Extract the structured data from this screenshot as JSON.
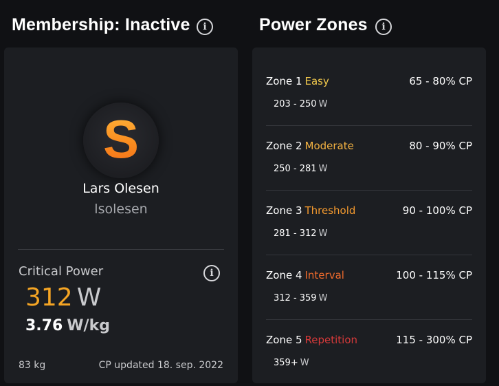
{
  "membership": {
    "title": "Membership: Inactive",
    "info_icon": "info-icon"
  },
  "profile": {
    "avatar_letter": "S",
    "name": "Lars Olesen",
    "username": "lsolesen"
  },
  "critical_power": {
    "label": "Critical Power",
    "value": "312",
    "unit": "W",
    "wkg_value": "3.76",
    "wkg_unit": "W/kg",
    "weight": "83 kg",
    "updated": "CP updated 18. sep. 2022"
  },
  "power_zones": {
    "title": "Power Zones",
    "zones": [
      {
        "prefix": "Zone 1",
        "label": "Easy",
        "color": "#f2c94c",
        "pct": "65 - 80% CP",
        "range": "203 - 250",
        "unit": "W"
      },
      {
        "prefix": "Zone 2",
        "label": "Moderate",
        "color": "#f5b342",
        "pct": "80 - 90% CP",
        "range": "250 - 281",
        "unit": "W"
      },
      {
        "prefix": "Zone 3",
        "label": "Threshold",
        "color": "#f59a2e",
        "pct": "90 - 100% CP",
        "range": "281 - 312",
        "unit": "W"
      },
      {
        "prefix": "Zone 4",
        "label": "Interval",
        "color": "#ee6a2c",
        "pct": "100 - 115% CP",
        "range": "312 - 359",
        "unit": "W"
      },
      {
        "prefix": "Zone 5",
        "label": "Repetition",
        "color": "#d83a3a",
        "pct": "115 - 300% CP",
        "range": "359+",
        "unit": "W"
      }
    ]
  },
  "colors": {
    "accent_orange": "#f5a524",
    "card_bg": "#1c1e22",
    "page_bg": "#101114"
  }
}
